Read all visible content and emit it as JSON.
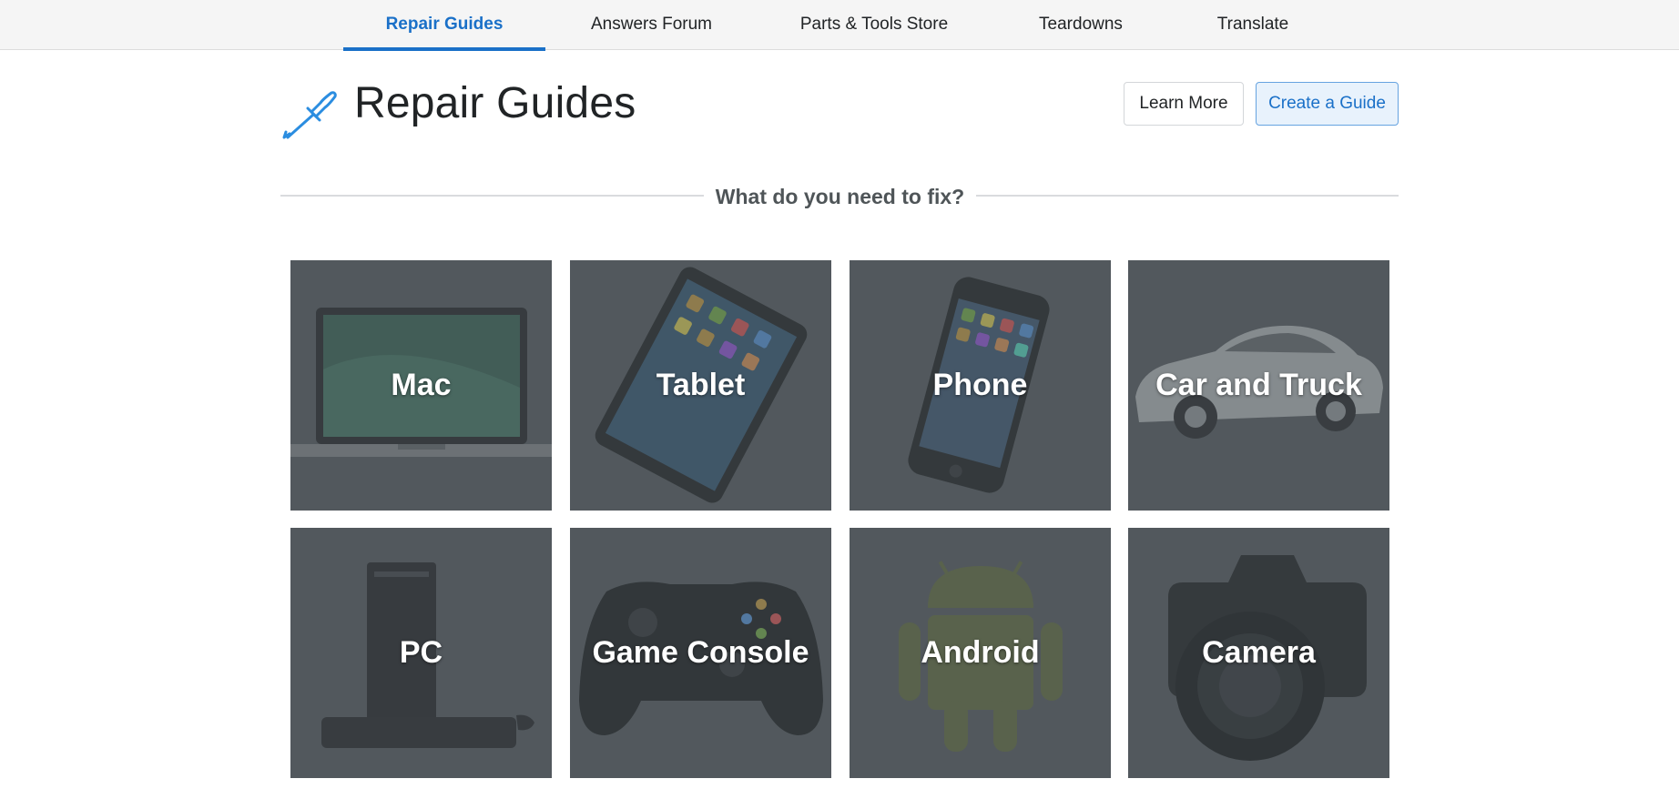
{
  "nav": {
    "tabs": [
      {
        "label": "Repair Guides",
        "active": true
      },
      {
        "label": "Answers Forum",
        "active": false
      },
      {
        "label": "Parts & Tools Store",
        "active": false
      },
      {
        "label": "Teardowns",
        "active": false
      },
      {
        "label": "Translate",
        "active": false
      }
    ]
  },
  "header": {
    "title": "Repair Guides",
    "icon": "screwdriver-icon",
    "learn_more_label": "Learn More",
    "create_guide_label": "Create a Guide"
  },
  "section": {
    "heading": "What do you need to fix?"
  },
  "categories": [
    {
      "label": "Mac",
      "icon": "laptop"
    },
    {
      "label": "Tablet",
      "icon": "tablet"
    },
    {
      "label": "Phone",
      "icon": "phone"
    },
    {
      "label": "Car and Truck",
      "icon": "car"
    },
    {
      "label": "PC",
      "icon": "desktop-pc"
    },
    {
      "label": "Game Console",
      "icon": "gamepad"
    },
    {
      "label": "Android",
      "icon": "android"
    },
    {
      "label": "Camera",
      "icon": "camera"
    }
  ],
  "colors": {
    "accent": "#1a70c8",
    "tile_bg": "#5b6266",
    "nav_bg": "#f5f5f5"
  }
}
